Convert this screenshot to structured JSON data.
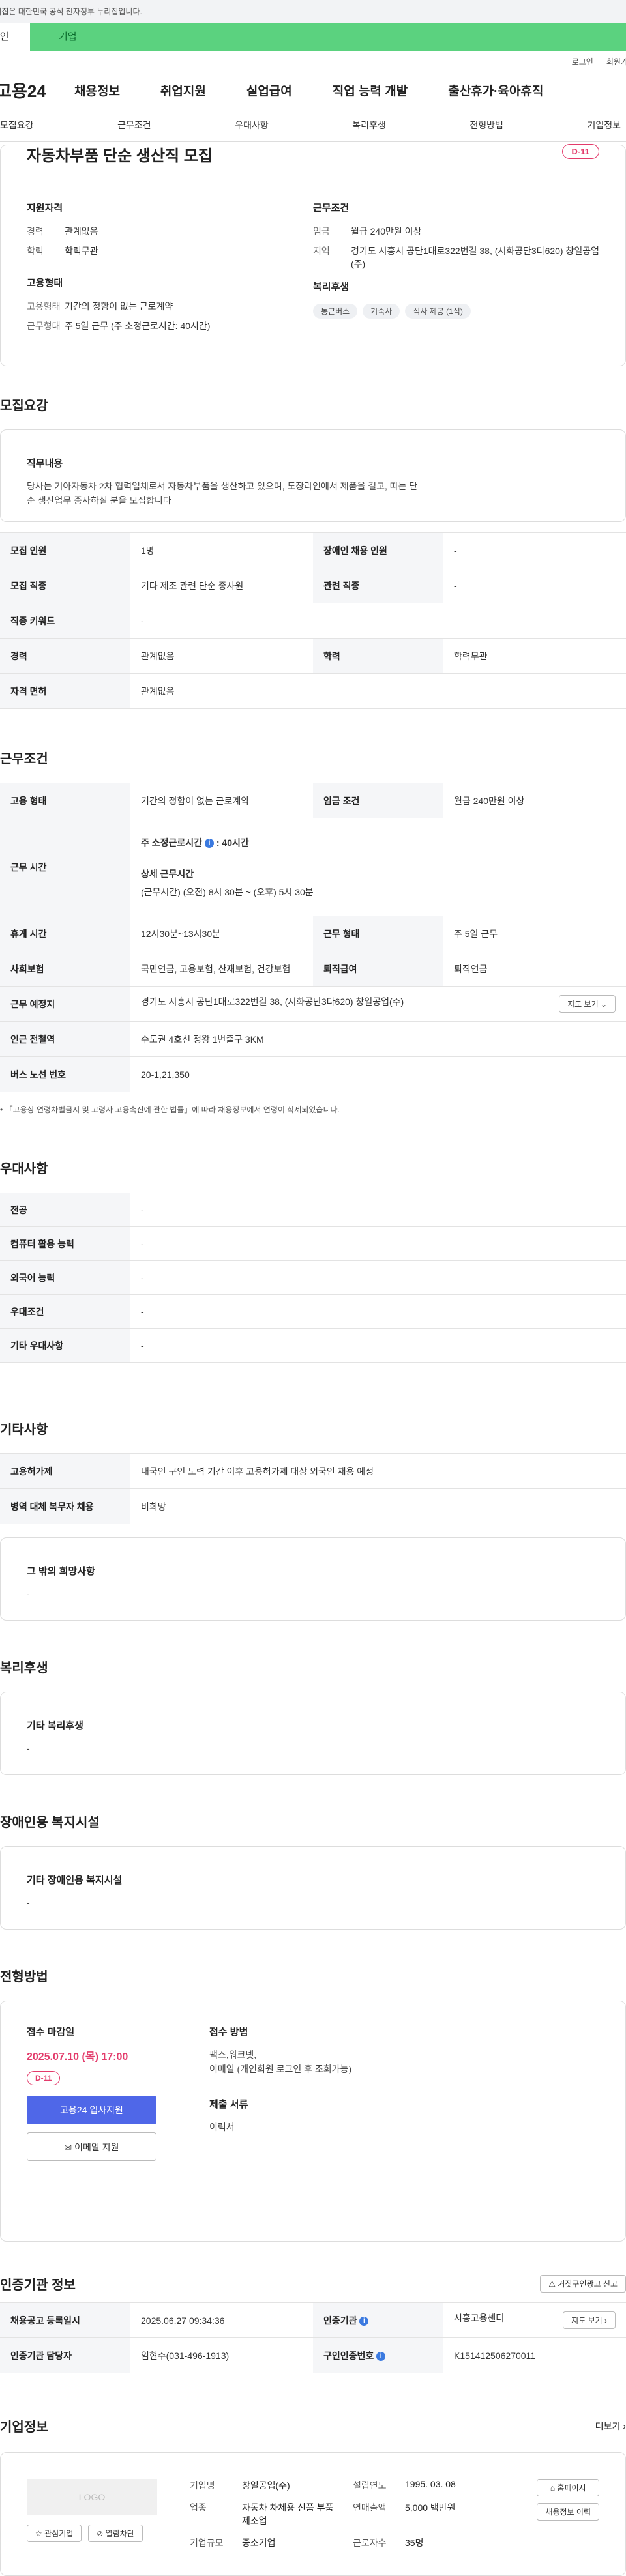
{
  "gov_notice": "이 누리집은 대한민국 공식 전자정부 누리집입니다.",
  "mode_tabs": {
    "individual": "개인",
    "business": "기업"
  },
  "util": {
    "login": "로그인",
    "join": "회원가입"
  },
  "brand": "고용24",
  "gnb": [
    "채용정보",
    "취업지원",
    "실업급여",
    "직업 능력 개발",
    "출산휴가·육아휴직"
  ],
  "tabs": [
    "모집요강",
    "근무조건",
    "우대사항",
    "복리후생",
    "전형방법",
    "기업정보"
  ],
  "summary": {
    "title": "자동차부품 단순 생산직 모집",
    "dday": "D-11",
    "req_h": "지원자격",
    "career_k": "경력",
    "career_v": "관계없음",
    "edu_k": "학력",
    "edu_v": "학력무관",
    "emp_h": "고용형태",
    "emptype_k": "고용형태",
    "emptype_v": "기간의 정함이 없는 근로계약",
    "workform_k": "근무형태",
    "workform_v": "주 5일 근무 (주 소정근로시간: 40시간)",
    "cond_h": "근무조건",
    "wage_k": "임금",
    "wage_v": "월급 240만원 이상",
    "region_k": "지역",
    "region_v": "경기도 시흥시 공단1대로322번길 38, (시화공단3다620) 창일공업(주)",
    "welfare_h": "복리후생",
    "chips": [
      "통근버스",
      "기숙사",
      "식사 제공 (1식)"
    ]
  },
  "recruit": {
    "title": "모집요강",
    "desc_h": "직무내용",
    "desc": "당사는 기아자동차 2차 협력업체로서 자동차부품을 생산하고 있으며, 도장라인에서 제품을 걸고, 따는 단순 생산업무 종사하실 분을 모집합니다",
    "headcount_k": "모집 인원",
    "headcount_v": "1명",
    "disabled_k": "장애인 채용 인원",
    "disabled_v": "-",
    "job_k": "모집 직종",
    "job_v": "기타 제조 관련 단순 종사원",
    "related_k": "관련 직종",
    "related_v": "-",
    "keyword_k": "직종 키워드",
    "keyword_v": "-",
    "career_k": "경력",
    "career_v": "관계없음",
    "edu_k": "학력",
    "edu_v": "학력무관",
    "license_k": "자격 면허",
    "license_v": "관계없음"
  },
  "work": {
    "title": "근무조건",
    "emptype_k": "고용 형태",
    "emptype_v": "기간의 정함이 없는 근로계약",
    "wage_k": "임금 조건",
    "wage_v": "월급 240만원 이상",
    "hours_k": "근무 시간",
    "weekly_label": "주 소정근로시간",
    "weekly_value": "40시간",
    "detail_h": "상세 근무시간",
    "detail_v": "(근무시간) (오전) 8시 30분 ~ (오후) 5시 30분",
    "rest_k": "휴게 시간",
    "rest_v": "12시30분~13시30분",
    "form_k": "근무 형태",
    "form_v": "주 5일 근무",
    "insurance_k": "사회보험",
    "insurance_v": "국민연금, 고용보험, 산재보험, 건강보험",
    "severance_k": "퇴직급여",
    "severance_v": "퇴직연금",
    "place_k": "근무 예정지",
    "place_v": "경기도 시흥시 공단1대로322번길 38, (시화공단3다620) 창일공업(주)",
    "map_btn": "지도 보기",
    "station_k": "인근 전철역",
    "station_v": "수도권 4호선 정왕 1번출구 3KM",
    "bus_k": "버스 노선 번호",
    "bus_v": "20-1,21,350",
    "note": "「고용상 연령차별금지 및 고령자 고용촉진에 관한 법률」에 따라 채용정보에서 연령이 삭제되었습니다."
  },
  "pref": {
    "title": "우대사항",
    "major_k": "전공",
    "major_v": "-",
    "computer_k": "컴퓨터 활용 능력",
    "computer_v": "-",
    "language_k": "외국어 능력",
    "language_v": "-",
    "cond_k": "우대조건",
    "cond_v": "-",
    "etc_k": "기타 우대사항",
    "etc_v": "-"
  },
  "other": {
    "title": "기타사항",
    "foreign_k": "고용허가제",
    "foreign_v": "내국인 구인 노력 기간 이후 고용허가제 대상 외국인 채용 예정",
    "military_k": "병역 대체 복무자 채용",
    "military_v": "비희망",
    "etc_h": "그 밖의 희망사항",
    "etc_v": "-"
  },
  "welfare": {
    "title": "복리후생",
    "etc_h": "기타 복리후생",
    "etc_v": "-"
  },
  "disabled_fac": {
    "title": "장애인용 복지시설",
    "etc_h": "기타 장애인용 복지시설",
    "etc_v": "-"
  },
  "selection": {
    "title": "전형방법",
    "deadline_h": "접수 마감일",
    "deadline": "2025.07.10 (목) 17:00",
    "dday": "D-11",
    "apply_btn": "고용24 입사지원",
    "email_btn": "이메일 지원",
    "method_h": "접수 방법",
    "method_v1": "팩스,워크넷,",
    "method_v2": "이메일 (개인회원 로그인 후 조회가능)",
    "docs_h": "제출 서류",
    "docs_v": "이력서"
  },
  "cert": {
    "title": "인증기관 정보",
    "report_btn": "거짓구인광고 신고",
    "reg_k": "채용공고 등록일시",
    "reg_v": "2025.06.27 09:34:36",
    "org_k": "인증기관",
    "org_v": "시흥고용센터",
    "map_btn": "지도 보기",
    "manager_k": "인증기관 담당자",
    "manager_v": "임현주(031-496-1913)",
    "no_k": "구인인증번호",
    "no_v": "K151412506270011"
  },
  "company": {
    "title": "기업정보",
    "more": "더보기",
    "logo": "LOGO",
    "fav_btn": "관심기업",
    "block_btn": "열람차단",
    "name_k": "기업명",
    "name_v": "창일공업(주)",
    "year_k": "설립연도",
    "year_v": "1995. 03. 08",
    "industry_k": "업종",
    "industry_v": "자동차 차체용 신품 부품 제조업",
    "sales_k": "연매출액",
    "sales_v": "5,000 백만원",
    "staff_k": "근로자수",
    "staff_v": "35명",
    "size_k": "기업규모",
    "size_v": "중소기업",
    "home_btn": "홈페이지",
    "history_btn": "채용정보 이력"
  }
}
